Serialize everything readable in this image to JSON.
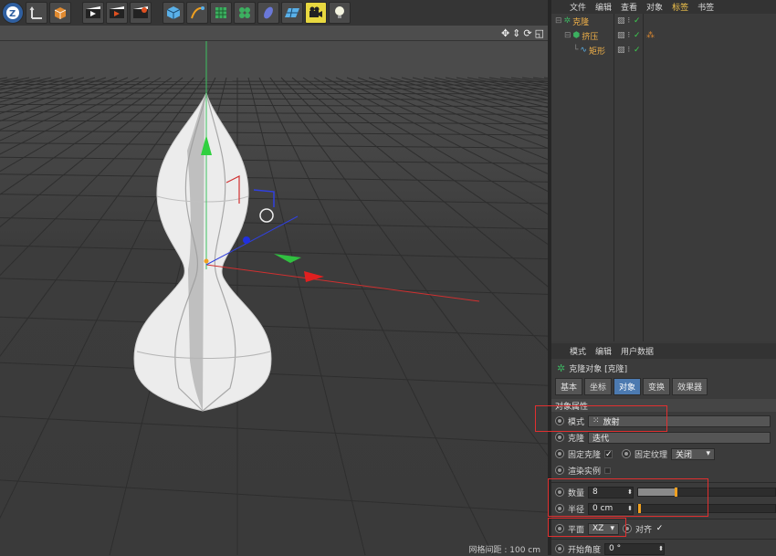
{
  "object_manager": {
    "menu": [
      "文件",
      "编辑",
      "查看",
      "对象",
      "标签",
      "书签"
    ],
    "active_menu_index": 4,
    "objects": [
      {
        "name": "克隆",
        "indent": 0,
        "icon": "cloner-icon"
      },
      {
        "name": "挤压",
        "indent": 1,
        "icon": "extrude-icon"
      },
      {
        "name": "矩形",
        "indent": 2,
        "icon": "spline-icon"
      }
    ]
  },
  "attribute_manager": {
    "menu": [
      "模式",
      "编辑",
      "用户数据"
    ],
    "title": "克隆对象 [克隆]",
    "tabs": [
      "基本",
      "坐标",
      "对象",
      "变换",
      "效果器"
    ],
    "active_tab_index": 2,
    "section_title": "对象属性",
    "mode_label": "模式",
    "mode_value": "放射",
    "clone_label": "克隆",
    "clone_value": "迭代",
    "fix_clone_label": "固定克隆",
    "fix_texture_label": "固定纹理",
    "fix_texture_value": "关闭",
    "render_instances_label": "渲染实例",
    "count_label": "数量",
    "count_value": "8",
    "radius_label": "半径",
    "radius_value": "0 cm",
    "plane_label": "平面",
    "plane_value": "XZ",
    "align_label": "对齐",
    "start_angle_label": "开始角度",
    "start_angle_value": "0 °"
  },
  "viewport": {
    "grid_spacing": "网格间距 : 100 cm"
  },
  "colors": {
    "accent": "#f2c34b",
    "active_tab": "#4c7ab0",
    "highlight_box": "#e03030"
  }
}
